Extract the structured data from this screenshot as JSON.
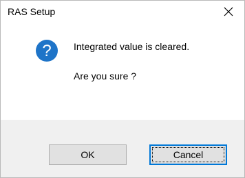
{
  "window": {
    "title": "RAS Setup",
    "close_icon": "close-icon"
  },
  "message": {
    "icon": "question-icon",
    "icon_color": "#1e74c8",
    "line1": "Integrated value is cleared.",
    "line2": "Are you sure ?"
  },
  "buttons": {
    "ok_label": "OK",
    "cancel_label": "Cancel",
    "default": "Cancel",
    "accent_color": "#0078d7"
  }
}
